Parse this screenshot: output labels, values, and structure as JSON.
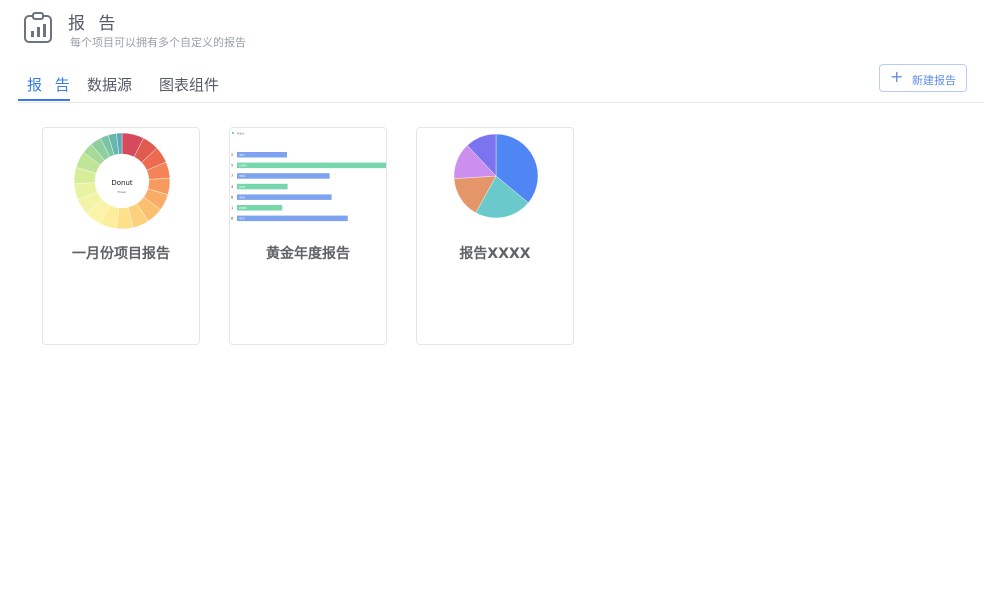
{
  "header": {
    "title": "报 告",
    "subtitle": "每个项目可以拥有多个自定义的报告",
    "icon": "clipboard-chart-icon"
  },
  "tabs": [
    {
      "label": "报 告",
      "active": true
    },
    {
      "label": "数据源",
      "active": false
    },
    {
      "label": "图表组件",
      "active": false
    }
  ],
  "new_button": {
    "label": "新建报告",
    "icon": "plus-icon"
  },
  "cards": [
    {
      "title": "一月份项目报告",
      "chart_label": "Donut",
      "chart_sublabel": "Hover"
    },
    {
      "title": "黄金年度报告"
    },
    {
      "title": "报告XXXX"
    }
  ],
  "colors": {
    "accent": "#3a7bea",
    "border": "#e3e5e8"
  },
  "chart_data": [
    {
      "type": "pie",
      "title": "Donut",
      "subtitle": "Hover",
      "donut": true,
      "values": [
        8,
        6,
        6,
        6,
        6,
        6,
        6,
        6,
        6,
        6,
        6,
        6,
        6,
        6,
        6,
        4,
        4,
        3,
        3,
        2
      ],
      "colors": [
        "#d64a5e",
        "#e05a4f",
        "#ec6b50",
        "#f48458",
        "#f79a5f",
        "#f9ad67",
        "#fbbf70",
        "#fcd07c",
        "#fde089",
        "#fdee9c",
        "#fbf4a8",
        "#f4f4a8",
        "#e7f3a2",
        "#d6ee9a",
        "#c1e597",
        "#a7da98",
        "#8fcf9e",
        "#79c4a4",
        "#66b8ae",
        "#5aa8b8"
      ]
    },
    {
      "type": "bar",
      "orientation": "horizontal",
      "legend": "Field",
      "categories": [
        "2",
        "5",
        "7",
        "4",
        "6",
        "1",
        "8"
      ],
      "values": [
        250,
        750,
        463,
        253,
        473,
        226,
        554
      ],
      "bar_labels": [
        "357",
        "1460",
        "386",
        "256",
        "449",
        "2886",
        "402"
      ],
      "colors": [
        "#7ea3f0",
        "#76d6ac"
      ]
    },
    {
      "type": "pie",
      "values": [
        36,
        22,
        16,
        14,
        12
      ],
      "colors": [
        "#4f86f4",
        "#6acacb",
        "#e4956a",
        "#cc8ff0",
        "#7b73ef"
      ]
    }
  ]
}
